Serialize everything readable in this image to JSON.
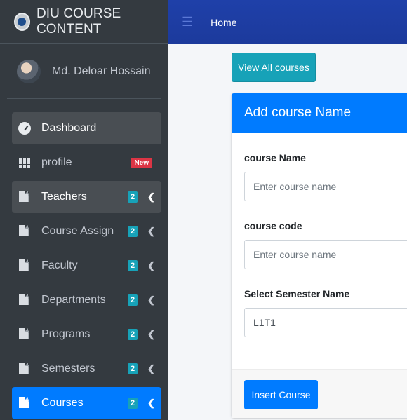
{
  "brand": {
    "title": "DIU COURSE CONTENT"
  },
  "user": {
    "name": "Md. Deloar Hossain"
  },
  "sidebar": {
    "items": [
      {
        "label": "Dashboard"
      },
      {
        "label": "profile",
        "badge": "New"
      },
      {
        "label": "Teachers",
        "badge": "2"
      },
      {
        "label": "Course Assign",
        "badge": "2"
      },
      {
        "label": "Faculty",
        "badge": "2"
      },
      {
        "label": "Departments",
        "badge": "2"
      },
      {
        "label": "Programs",
        "badge": "2"
      },
      {
        "label": "Semesters",
        "badge": "2"
      },
      {
        "label": "Courses",
        "badge": "2"
      }
    ]
  },
  "topbar": {
    "home": "Home"
  },
  "actions": {
    "view_all": "View All courses"
  },
  "form": {
    "title": "Add course Name",
    "course_name_label": "course Name",
    "course_name_placeholder": "Enter course name",
    "course_code_label": "course code",
    "course_code_placeholder": "Enter course name",
    "semester_label": "Select Semester Name",
    "semester_value": "L1T1",
    "submit_label": "Insert Course"
  },
  "colors": {
    "sidebar_bg": "#343a40",
    "topbar_bg": "#1f40a9",
    "primary": "#007bff",
    "info": "#17a2b8",
    "danger": "#dc3545"
  }
}
